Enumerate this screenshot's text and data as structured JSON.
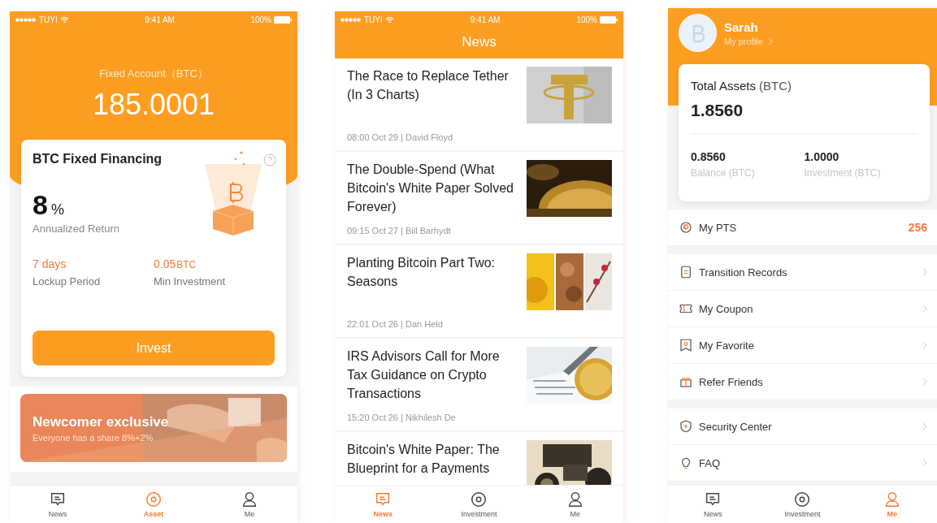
{
  "asset_screen": {
    "status_bar": {
      "carrier": "TUYI",
      "time": "9:41 AM",
      "battery": "100%"
    },
    "account_label": "Fixed Account（BTC）",
    "account_value": "185.0001",
    "product": {
      "title": "BTC Fixed Financing",
      "rate": "8",
      "rate_unit": "%",
      "rate_label": "Annualized Return",
      "stats": [
        {
          "value": "7 days",
          "label": "Lockup Period"
        },
        {
          "value": "0.05",
          "unit": "BTC",
          "label": "Min Investment"
        }
      ],
      "button": "Invest"
    },
    "banner": {
      "title": "Newcomer exclusive",
      "subtitle": "Everyone has a share 8%+2%"
    },
    "tabs": [
      {
        "label": "News",
        "selected": false
      },
      {
        "label": "Asset",
        "selected": true
      },
      {
        "label": "Me",
        "selected": false
      }
    ]
  },
  "news_screen": {
    "status_bar": {
      "carrier": "TUYI",
      "time": "9:41 AM",
      "battery": "100%"
    },
    "title": "News",
    "articles": [
      {
        "title": "The Race to Replace Tether (In 3 Charts)",
        "meta": "08:00 Oct 29 | David Floyd"
      },
      {
        "title": "The Double-Spend (What Bitcoin's White Paper Solved Forever)",
        "meta": "09:15 Oct 27 | Bill Barhydt"
      },
      {
        "title": "Planting Bitcoin Part Two: Seasons",
        "meta": "22:01 Oct 26 | Dan Held"
      },
      {
        "title": "IRS Advisors Call for More Tax Guidance on Crypto Transactions",
        "meta": "15:20 Oct 26 | Nikhilesh De"
      },
      {
        "title": "Bitcoin's White Paper: The Blueprint for a Payments"
      }
    ],
    "tabs": [
      {
        "label": "News",
        "selected": true
      },
      {
        "label": "Investment",
        "selected": false
      },
      {
        "label": "Me",
        "selected": false
      }
    ]
  },
  "me_screen": {
    "name": "Sarah",
    "profile_link": "My profile",
    "assets": {
      "title": "Total Assets",
      "unit": "(BTC)",
      "value": "1.8560",
      "stats": [
        {
          "value": "0.8560",
          "label": "Balance (BTC)"
        },
        {
          "value": "1.0000",
          "label": "Investment (BTC)"
        }
      ]
    },
    "menu_groups": [
      {
        "items": [
          {
            "label": "My PTS",
            "value": "256"
          }
        ]
      },
      {
        "items": [
          {
            "label": "Transition Records"
          },
          {
            "label": "My Coupon"
          },
          {
            "label": "My Favorite"
          },
          {
            "label": "Refer Friends"
          }
        ]
      },
      {
        "items": [
          {
            "label": "Security Center"
          },
          {
            "label": "FAQ"
          }
        ]
      }
    ],
    "tabs": [
      {
        "label": "News",
        "selected": false
      },
      {
        "label": "Investment",
        "selected": false
      },
      {
        "label": "Me",
        "selected": true
      }
    ]
  }
}
